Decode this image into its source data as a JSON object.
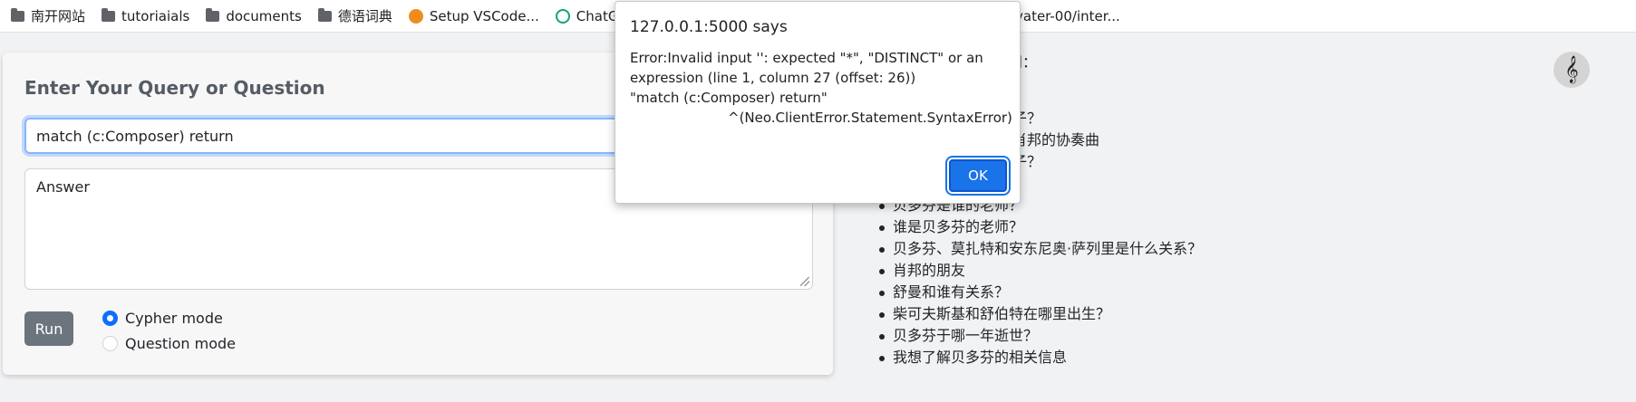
{
  "bookmarks": [
    {
      "label": "南开网站",
      "icon": "folder-icon"
    },
    {
      "label": "tutoriaials",
      "icon": "folder-icon"
    },
    {
      "label": "documents",
      "icon": "folder-icon"
    },
    {
      "label": "德语词典",
      "icon": "folder-icon"
    },
    {
      "label": "Setup VSCode...",
      "icon": "vscode-favicon"
    },
    {
      "label": "ChatGPT",
      "icon": "chatgpt-favicon"
    }
  ],
  "bookmark_truncated": "vater-00/inter...",
  "card": {
    "title": "Enter Your Query or Question",
    "query_value": "match (c:Composer) return",
    "answer_placeholder": "Answer",
    "run_label": "Run",
    "modes": [
      {
        "label": "Cypher mode",
        "selected": true
      },
      {
        "label": "Question mode",
        "selected": false
      }
    ]
  },
  "examples": {
    "head_partial": "提问：",
    "items": [
      "曲？",
      "曲子？",
      "和肖邦的协奏曲",
      "曲子？",
      "",
      "贝多芬是谁的老师？",
      "谁是贝多芬的老师？",
      "贝多芬、莫扎特和安东尼奥·萨列里是什么关系？",
      "肖邦的朋友",
      "舒曼和谁有关系？",
      "柴可夫斯基和舒伯特在哪里出生？",
      "贝多芬于哪一年逝世？",
      "我想了解贝多芬的相关信息"
    ]
  },
  "music_button_icon": "treble-clef-icon",
  "dialog": {
    "title": "127.0.0.1:5000 says",
    "line1": "Error:Invalid input '': expected \"*\", \"DISTINCT\" or an expression (line 1, column 27 (offset: 26))",
    "line2": "\"match (c:Composer) return\"",
    "line3": "^(Neo.ClientError.Statement.SyntaxError)",
    "ok_label": "OK"
  }
}
